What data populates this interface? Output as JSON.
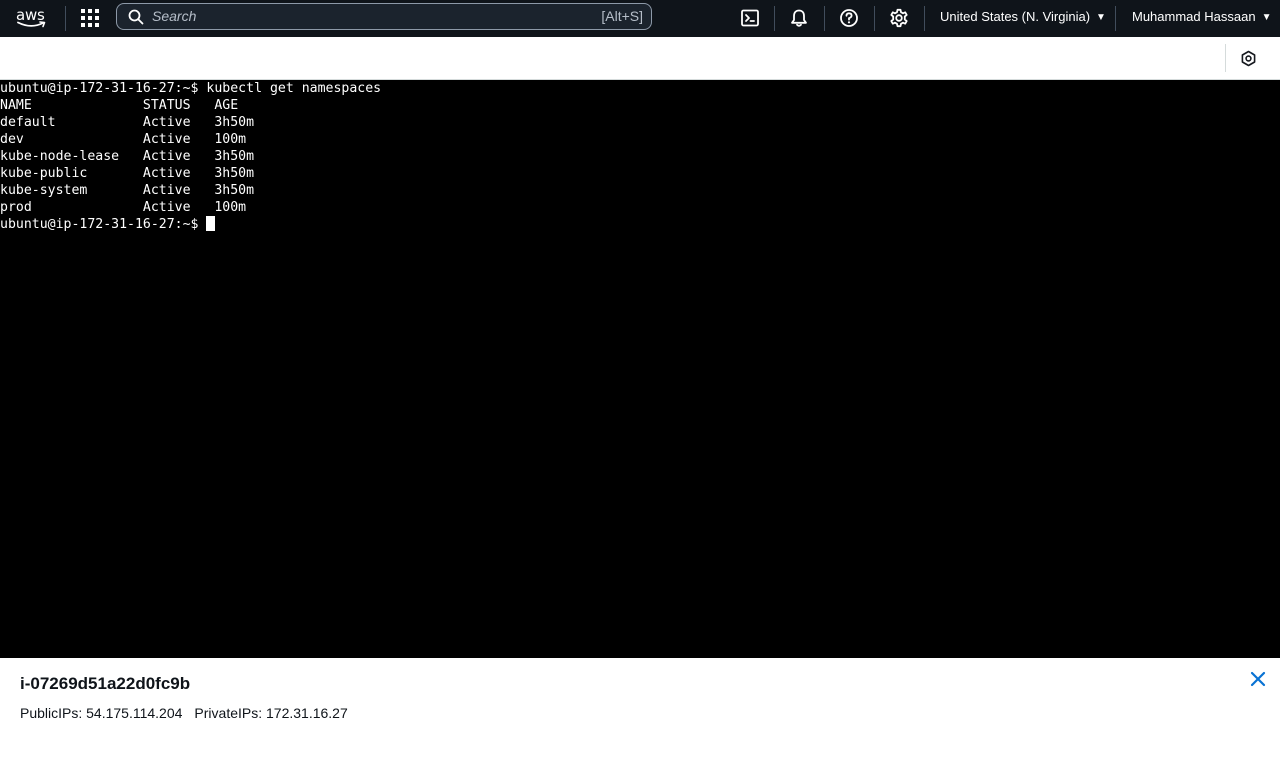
{
  "topnav": {
    "logo_text": "aws",
    "search": {
      "placeholder": "Search",
      "value": "",
      "shortcut": "[Alt+S]"
    },
    "icons": [
      "services-grid-icon",
      "cloudshell-icon",
      "bell-icon",
      "help-icon",
      "gear-icon"
    ],
    "region": "United States (N. Virginia)",
    "user": "Muhammad Hassaan",
    "colors": {
      "background": "#0f141a",
      "search_bg": "#1b232d",
      "search_border": "#8d99a8"
    }
  },
  "session_toolbar": {
    "icons": [
      "preferences-icon"
    ]
  },
  "terminal": {
    "colors": {
      "background": "#000000",
      "foreground": "#ffffff"
    },
    "lines": [
      "ubuntu@ip-172-31-16-27:~$ kubectl get namespaces",
      "NAME              STATUS   AGE",
      "default           Active   3h50m",
      "dev               Active   100m",
      "kube-node-lease   Active   3h50m",
      "kube-public       Active   3h50m",
      "kube-system       Active   3h50m",
      "prod              Active   100m"
    ],
    "prompt": "ubuntu@ip-172-31-16-27:~$ "
  },
  "instance": {
    "id": "i-07269d51a22d0fc9b",
    "public_ips": "PublicIPs: 54.175.114.204",
    "private_ips": "PrivateIPs: 172.31.16.27",
    "close_icon": "close-icon",
    "accent": "#0972d3"
  }
}
